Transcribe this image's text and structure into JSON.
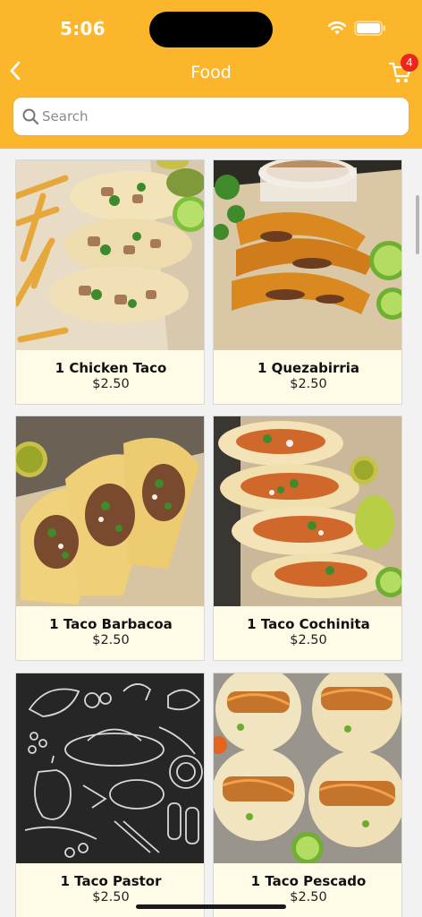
{
  "status_bar": {
    "time": "5:06"
  },
  "nav": {
    "title": "Food",
    "cart_count": "4"
  },
  "search": {
    "placeholder": "Search",
    "value": ""
  },
  "items": [
    {
      "name": "1 Chicken Taco",
      "price": "$2.50",
      "image": "chicken-taco-photo"
    },
    {
      "name": "1 Quezabirria",
      "price": "$2.50",
      "image": "quezabirria-photo"
    },
    {
      "name": "1 Taco Barbacoa",
      "price": "$2.50",
      "image": "barbacoa-taco-photo"
    },
    {
      "name": "1 Taco Cochinita",
      "price": "$2.50",
      "image": "cochinita-taco-photo"
    },
    {
      "name": "1 Taco Pastor",
      "price": "$2.50",
      "image": "food-doodle-placeholder"
    },
    {
      "name": "1 Taco Pescado",
      "price": "$2.50",
      "image": "pescado-taco-photo"
    }
  ],
  "colors": {
    "header": "#fbb62b",
    "card_bg": "#fffbe6",
    "badge": "#e8271e"
  }
}
